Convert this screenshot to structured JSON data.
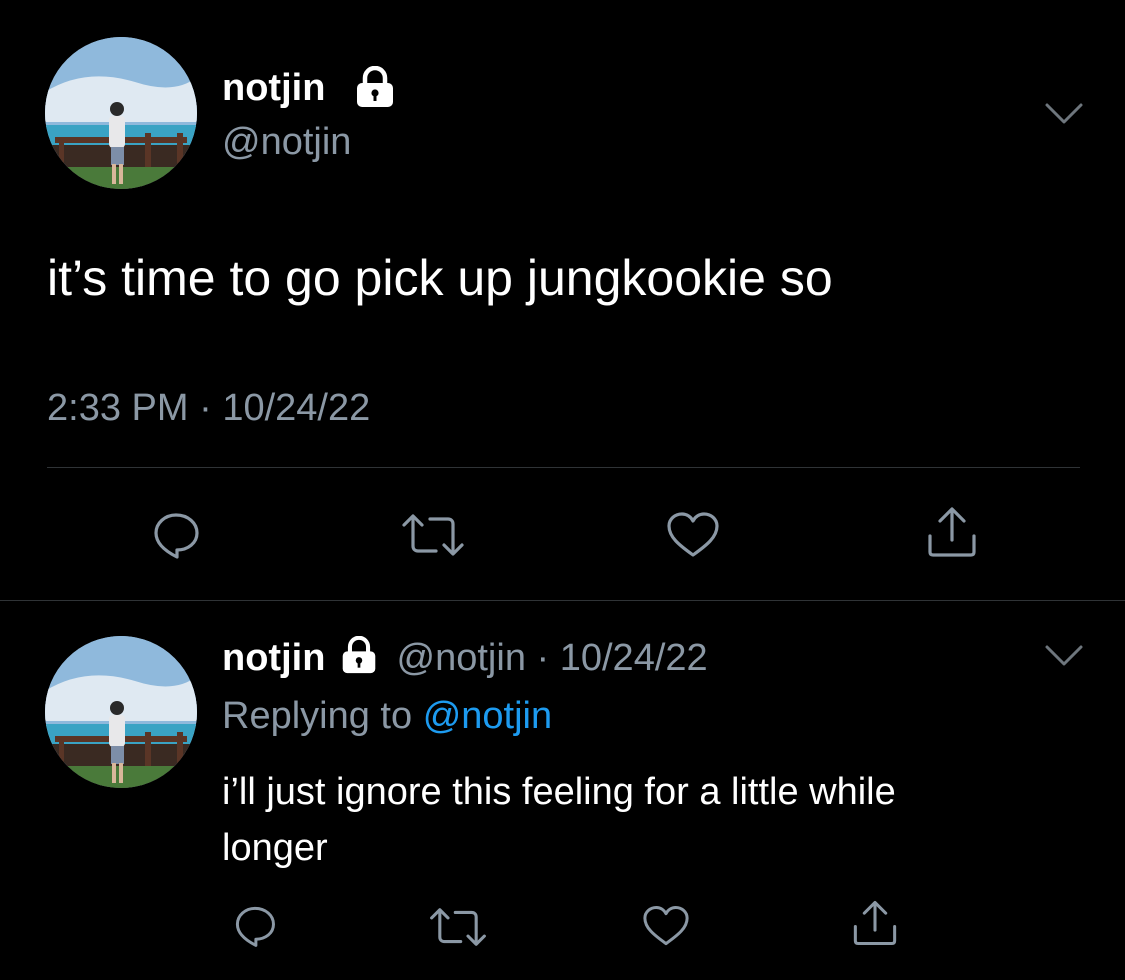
{
  "tweet": {
    "display_name": "notjin",
    "handle": "@notjin",
    "text": "it’s time to go pick up jungkookie so",
    "time": "2:33 PM",
    "separator": "·",
    "date": "10/24/22",
    "icons": {
      "lock": "lock-icon",
      "menu": "chevron-down-icon",
      "reply": "reply-icon",
      "retweet": "retweet-icon",
      "like": "heart-icon",
      "share": "share-icon"
    }
  },
  "reply": {
    "display_name": "notjin",
    "handle": "@notjin",
    "separator": "·",
    "date": "10/24/22",
    "replying_prefix": "Replying to",
    "replying_handle": "@notjin",
    "text_line1": "i’ll just ignore this feeling for a little while",
    "text_line2": "longer"
  },
  "colors": {
    "background": "#000000",
    "text": "#ffffff",
    "muted": "#8b98a5",
    "link": "#1d9bf0",
    "divider": "#2f3336"
  }
}
